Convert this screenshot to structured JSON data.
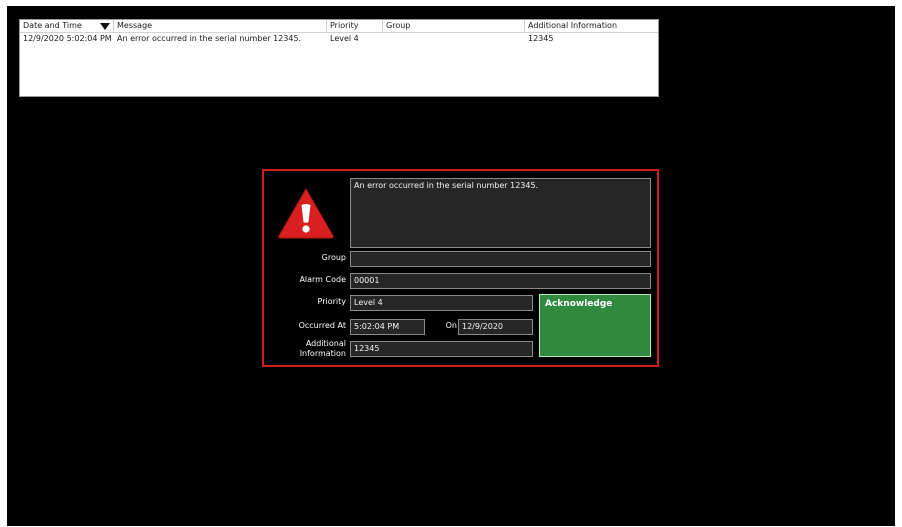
{
  "table": {
    "columns": [
      "Date and Time",
      "Message",
      "Priority",
      "Group",
      "Additional Information"
    ],
    "rows": [
      {
        "datetime": "12/9/2020 5:02:04 PM",
        "message": "An error occurred in the serial number 12345.",
        "priority": "Level 4",
        "group": "",
        "additional": "12345"
      }
    ]
  },
  "popup": {
    "message": "An error occurred in the serial number 12345.",
    "group_label": "Group",
    "group_value": "",
    "alarm_code_label": "Alarm Code",
    "alarm_code_value": "00001",
    "priority_label": "Priority",
    "priority_value": "Level 4",
    "occurred_label": "Occurred At",
    "occurred_value": "5:02:04 PM",
    "on_label": "On",
    "on_value": "12/9/2020",
    "additional_label_1": "Additional",
    "additional_label_2": "Information",
    "additional_value": "12345",
    "acknowledge_label": "Acknowledge"
  },
  "colors": {
    "popup_border": "#d21c1c",
    "acknowledge_bg": "#2f8a3e",
    "warning_icon": "#d82020"
  },
  "icons": {
    "warning": "warning-triangle-icon",
    "sort": "sort-descending-icon"
  }
}
